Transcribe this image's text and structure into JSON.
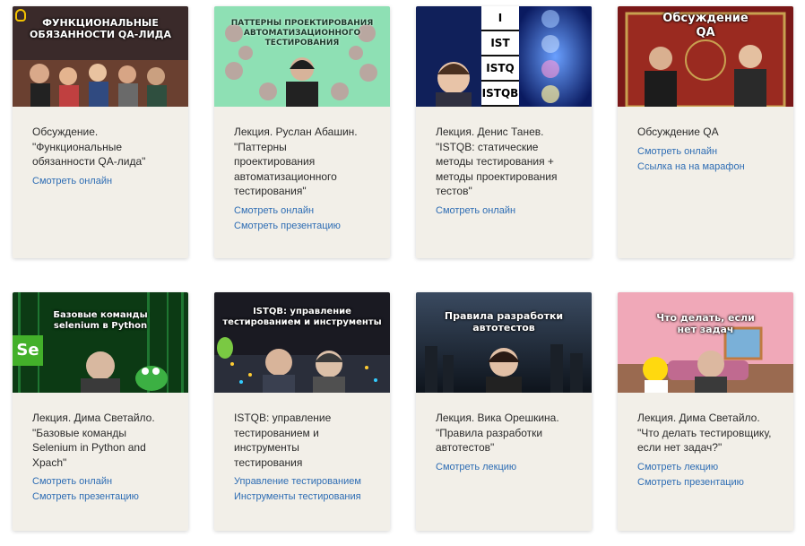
{
  "cards": [
    {
      "thumb_title": "ФУНКЦИОНАЛЬНЫЕ\nОБЯЗАННОСТИ QA-ЛИДА",
      "title": "Обсуждение.\n\"Функциональные\nобязанности QA-лида\"",
      "links": [
        "Смотреть онлайн"
      ]
    },
    {
      "thumb_title": "ПАТТЕРНЫ ПРОЕКТИРОВАНИЯ\nАВТОМАТИЗАЦИОННОГО\nТЕСТИРОВАНИЯ",
      "title": "Лекция. Руслан Абашин.\n\"Паттерны\nпроектирования\nавтоматизационного\nтестирования\"",
      "links": [
        "Смотреть онлайн",
        "Смотреть презентацию"
      ]
    },
    {
      "thumb_levels": [
        "I",
        "IST",
        "ISTQ",
        "ISTQB"
      ],
      "title": "Лекция. Денис Танев.\n\"ISTQB: статические\nметоды тестирования +\nметоды проектирования\nтестов\"",
      "links": [
        "Смотреть онлайн"
      ]
    },
    {
      "thumb_title": "Обсуждение\nQA",
      "title": "Обсуждение QA",
      "links": [
        "Смотреть онлайн",
        "Ссылка на на марафон"
      ]
    },
    {
      "thumb_title": "Базовые команды\nselenium в Python",
      "thumb_logo": "Se",
      "title": "Лекция. Дима Светайло.\n\"Базовые команды\nSelenium in Python and\nXpach\"",
      "links": [
        "Смотреть онлайн",
        "Смотреть презентацию"
      ]
    },
    {
      "thumb_title": "ISTQB: управление\nтестированием и инструменты",
      "title": "ISTQB: управление\nтестированием и\nинструменты\nтестирования",
      "links": [
        "Управление тестированием",
        "Инструменты тестирования"
      ]
    },
    {
      "thumb_title": "Правила разработки\nавтотестов",
      "title": "Лекция. Вика Орешкина.\n\"Правила разработки\nавтотестов\"",
      "links": [
        "Смотреть лекцию"
      ]
    },
    {
      "thumb_title": "Что делать, если\nнет задач",
      "title": "Лекция. Дима Светайло.\n\"Что делать тестировщику,\nесли нет задач?\"",
      "links": [
        "Смотреть лекцию",
        "Смотреть презентацию"
      ]
    }
  ],
  "colors": {
    "card_bg": "#f2efe8",
    "link": "#2e6db4",
    "text": "#2b2b2b",
    "selenium_green": "#43b02a"
  }
}
